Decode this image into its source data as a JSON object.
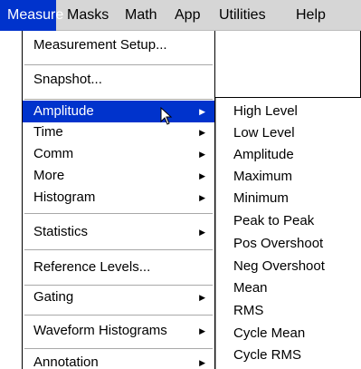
{
  "menubar": {
    "items": [
      {
        "label": "Measure",
        "active": true
      },
      {
        "label": "Masks"
      },
      {
        "label": "Math"
      },
      {
        "label": "App"
      },
      {
        "label": "Utilities"
      },
      {
        "label": "Help"
      }
    ]
  },
  "measure_menu": {
    "items": [
      {
        "label": "Measurement Setup..."
      },
      {
        "label": "Snapshot..."
      },
      {
        "label": "Amplitude",
        "submenu": true,
        "highlighted": true
      },
      {
        "label": "Time",
        "submenu": true
      },
      {
        "label": "Comm",
        "submenu": true
      },
      {
        "label": "More",
        "submenu": true
      },
      {
        "label": "Histogram",
        "submenu": true
      },
      {
        "label": "Statistics",
        "submenu": true
      },
      {
        "label": "Reference Levels..."
      },
      {
        "label": "Gating",
        "submenu": true
      },
      {
        "label": "Waveform Histograms",
        "submenu": true
      },
      {
        "label": "Annotation",
        "submenu": true
      }
    ]
  },
  "amplitude_submenu": {
    "items": [
      {
        "label": "High Level"
      },
      {
        "label": "Low Level"
      },
      {
        "label": "Amplitude"
      },
      {
        "label": "Maximum"
      },
      {
        "label": "Minimum"
      },
      {
        "label": "Peak to Peak"
      },
      {
        "label": "Pos Overshoot"
      },
      {
        "label": "Neg Overshoot"
      },
      {
        "label": "Mean"
      },
      {
        "label": "RMS"
      },
      {
        "label": "Cycle Mean"
      },
      {
        "label": "Cycle RMS"
      }
    ]
  },
  "icons": {
    "submenu_arrow": "triangle-right-icon",
    "cursor": "mouse-pointer-icon"
  },
  "colors": {
    "highlight": "#0033cc",
    "menubar_bg": "#d6d6d6"
  }
}
